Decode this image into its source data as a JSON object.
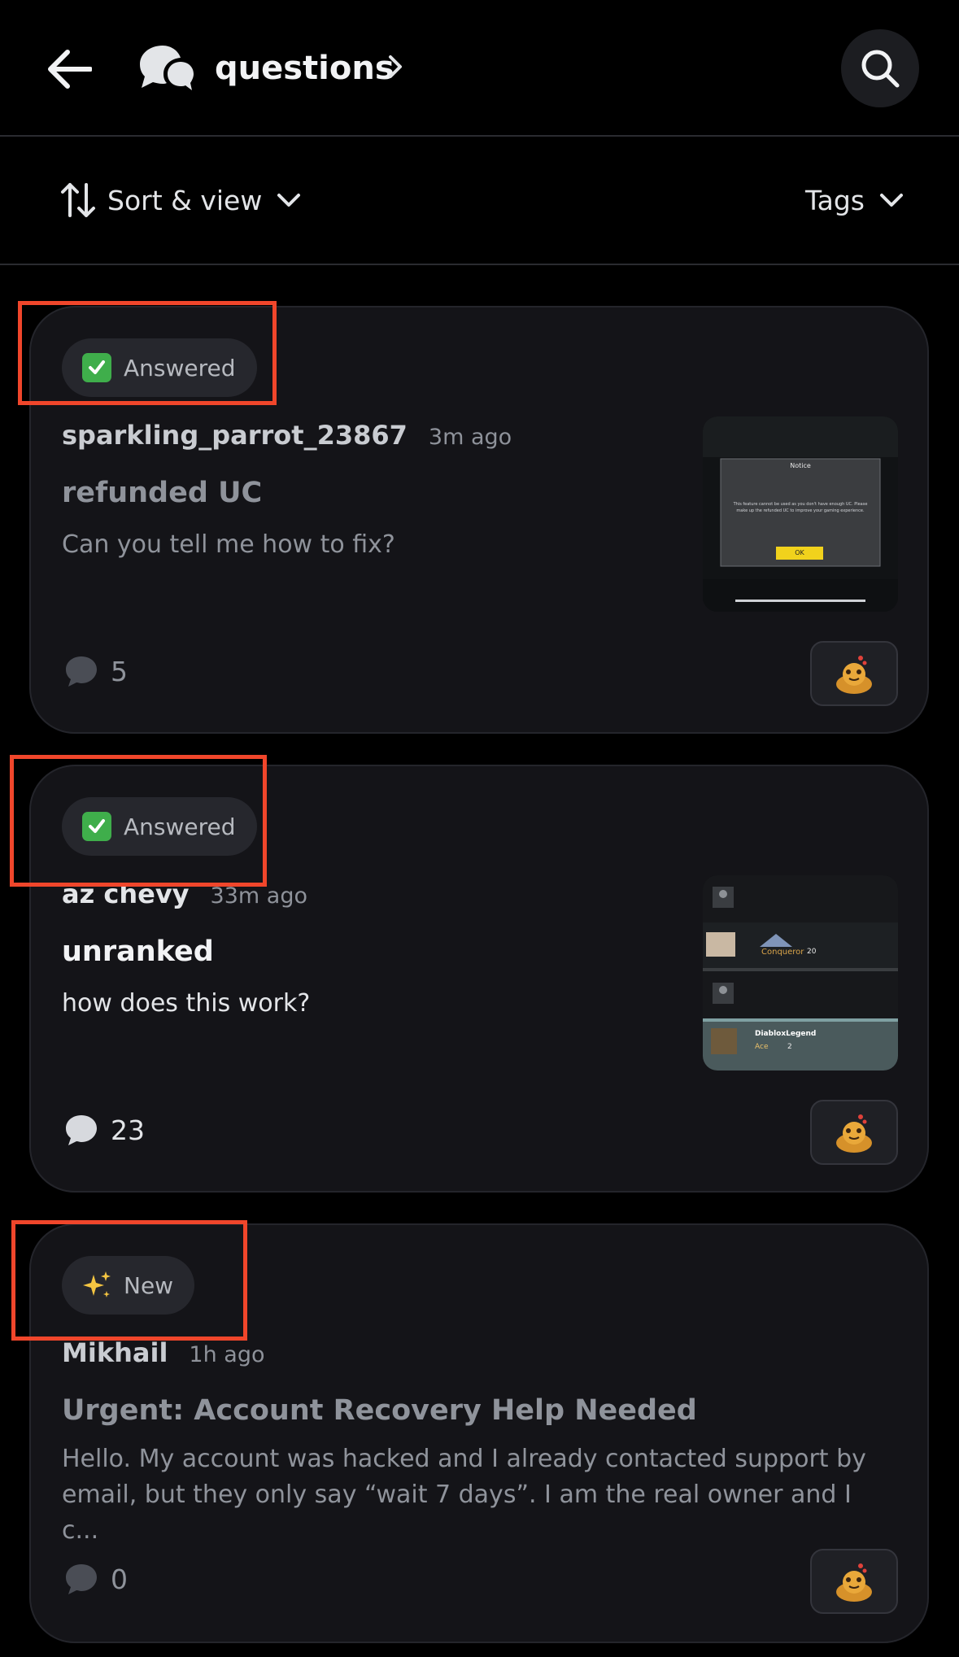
{
  "header": {
    "channel_name": "questions",
    "back_icon": "arrow-left-icon",
    "search_icon": "search-icon"
  },
  "toolbar": {
    "sort_label": "Sort & view",
    "tags_label": "Tags"
  },
  "colors": {
    "background": "#000000",
    "card": "#141418",
    "highlight": "#f0462b",
    "answered_check": "#3fae4b"
  },
  "posts": [
    {
      "badge": "Answered",
      "badge_icon": "check-mark-icon",
      "author": "sparkling_parrot_23867",
      "time": "3m ago",
      "title": "refunded UC",
      "body": "Can you tell me how to fix?",
      "comments": "5",
      "thumbnail": {
        "heading": "Notice",
        "message": "This feature cannot be used as you don't have enough UC. Please make up the refunded UC to improve your gaming experience.",
        "button": "OK"
      },
      "read": true
    },
    {
      "badge": "Answered",
      "badge_icon": "check-mark-icon",
      "author": "az chevy",
      "time": "33m ago",
      "title": "unranked",
      "body": "how does this work?",
      "comments": "23",
      "thumbnail": {
        "row2_rank": "Conqueror",
        "row2_points": "20",
        "row4_name": "DiabloxLegend",
        "row4_rank": "Ace",
        "row4_points": "2"
      },
      "read": false
    },
    {
      "badge": "New",
      "badge_icon": "sparkles-icon",
      "author": "Mikhail",
      "time": "1h ago",
      "title": "Urgent: Account Recovery Help Needed",
      "body": "Hello. My account was hacked and I already contacted support by email, but they only say “wait 7 days”. I am the real owner and I c...",
      "comments": "0",
      "read": true
    }
  ]
}
